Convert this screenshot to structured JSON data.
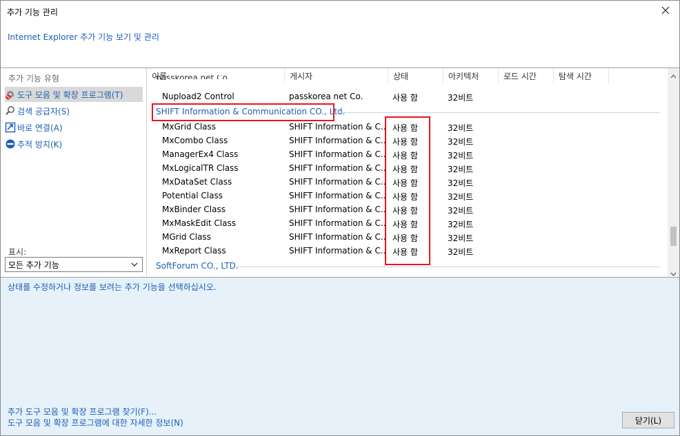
{
  "window": {
    "title": "추가 기능 관리"
  },
  "header": {
    "link": "Internet Explorer 추가 기능 보기 및 관리"
  },
  "sidebar": {
    "heading": "추가 기능 유형",
    "items": [
      {
        "label": "도구 모음 및 확장 프로그램(T)",
        "icon": "toolbar-gear-icon"
      },
      {
        "label": "검색 공급자(S)",
        "icon": "search-icon"
      },
      {
        "label": "바로 연결(A)",
        "icon": "accelerator-icon"
      },
      {
        "label": "추적 방지(K)",
        "icon": "block-icon"
      }
    ],
    "show_label": "표시:",
    "show_value": "모든 추가 기능"
  },
  "columns": [
    "이름",
    "게시자",
    "상태",
    "아키텍처",
    "로드 시간",
    "탐색 시간"
  ],
  "list": {
    "partial_row": "passkorea net Co.",
    "rows_before": [
      {
        "name": "Nupload2 Control",
        "publisher": "passkorea net Co.",
        "status": "사용 함",
        "arch": "32비트"
      }
    ],
    "group1": "SHIFT Information & Communication CO., Ltd.",
    "group1_rows": [
      {
        "name": "MxGrid Class",
        "publisher": "SHIFT Information & C...",
        "status": "사용 함",
        "arch": "32비트"
      },
      {
        "name": "MxCombo Class",
        "publisher": "SHIFT Information & C...",
        "status": "사용 함",
        "arch": "32비트"
      },
      {
        "name": "ManagerEx4 Class",
        "publisher": "SHIFT Information & C...",
        "status": "사용 함",
        "arch": "32비트"
      },
      {
        "name": "MxLogicalTR Class",
        "publisher": "SHIFT Information & C...",
        "status": "사용 함",
        "arch": "32비트"
      },
      {
        "name": "MxDataSet Class",
        "publisher": "SHIFT Information & C...",
        "status": "사용 함",
        "arch": "32비트"
      },
      {
        "name": "Potential Class",
        "publisher": "SHIFT Information & C...",
        "status": "사용 함",
        "arch": "32비트"
      },
      {
        "name": "MxBinder Class",
        "publisher": "SHIFT Information & C...",
        "status": "사용 함",
        "arch": "32비트"
      },
      {
        "name": "MxMaskEdit Class",
        "publisher": "SHIFT Information & C...",
        "status": "사용 함",
        "arch": "32비트"
      },
      {
        "name": "MGrid Class",
        "publisher": "SHIFT Information & C...",
        "status": "사용 함",
        "arch": "32비트"
      },
      {
        "name": "MxReport Class",
        "publisher": "SHIFT Information & C...",
        "status": "사용 함",
        "arch": "32비트"
      }
    ],
    "group2": "SoftForum CO., LTD."
  },
  "details": {
    "text": "상태를 수정하거나 정보를 보려는 추가 기능을 선택하십시오."
  },
  "footer": {
    "link1": "추가 도구 모음 및 확장 프로그램 찾기(F)...",
    "link2": "도구 모음 및 확장 프로그램에 대한 자세한 정보(N)",
    "close_label": "닫기(L)"
  },
  "colors": {
    "link": "#1a5fb4",
    "highlight": "#e8141b",
    "details_bg": "#e6f1fa"
  }
}
